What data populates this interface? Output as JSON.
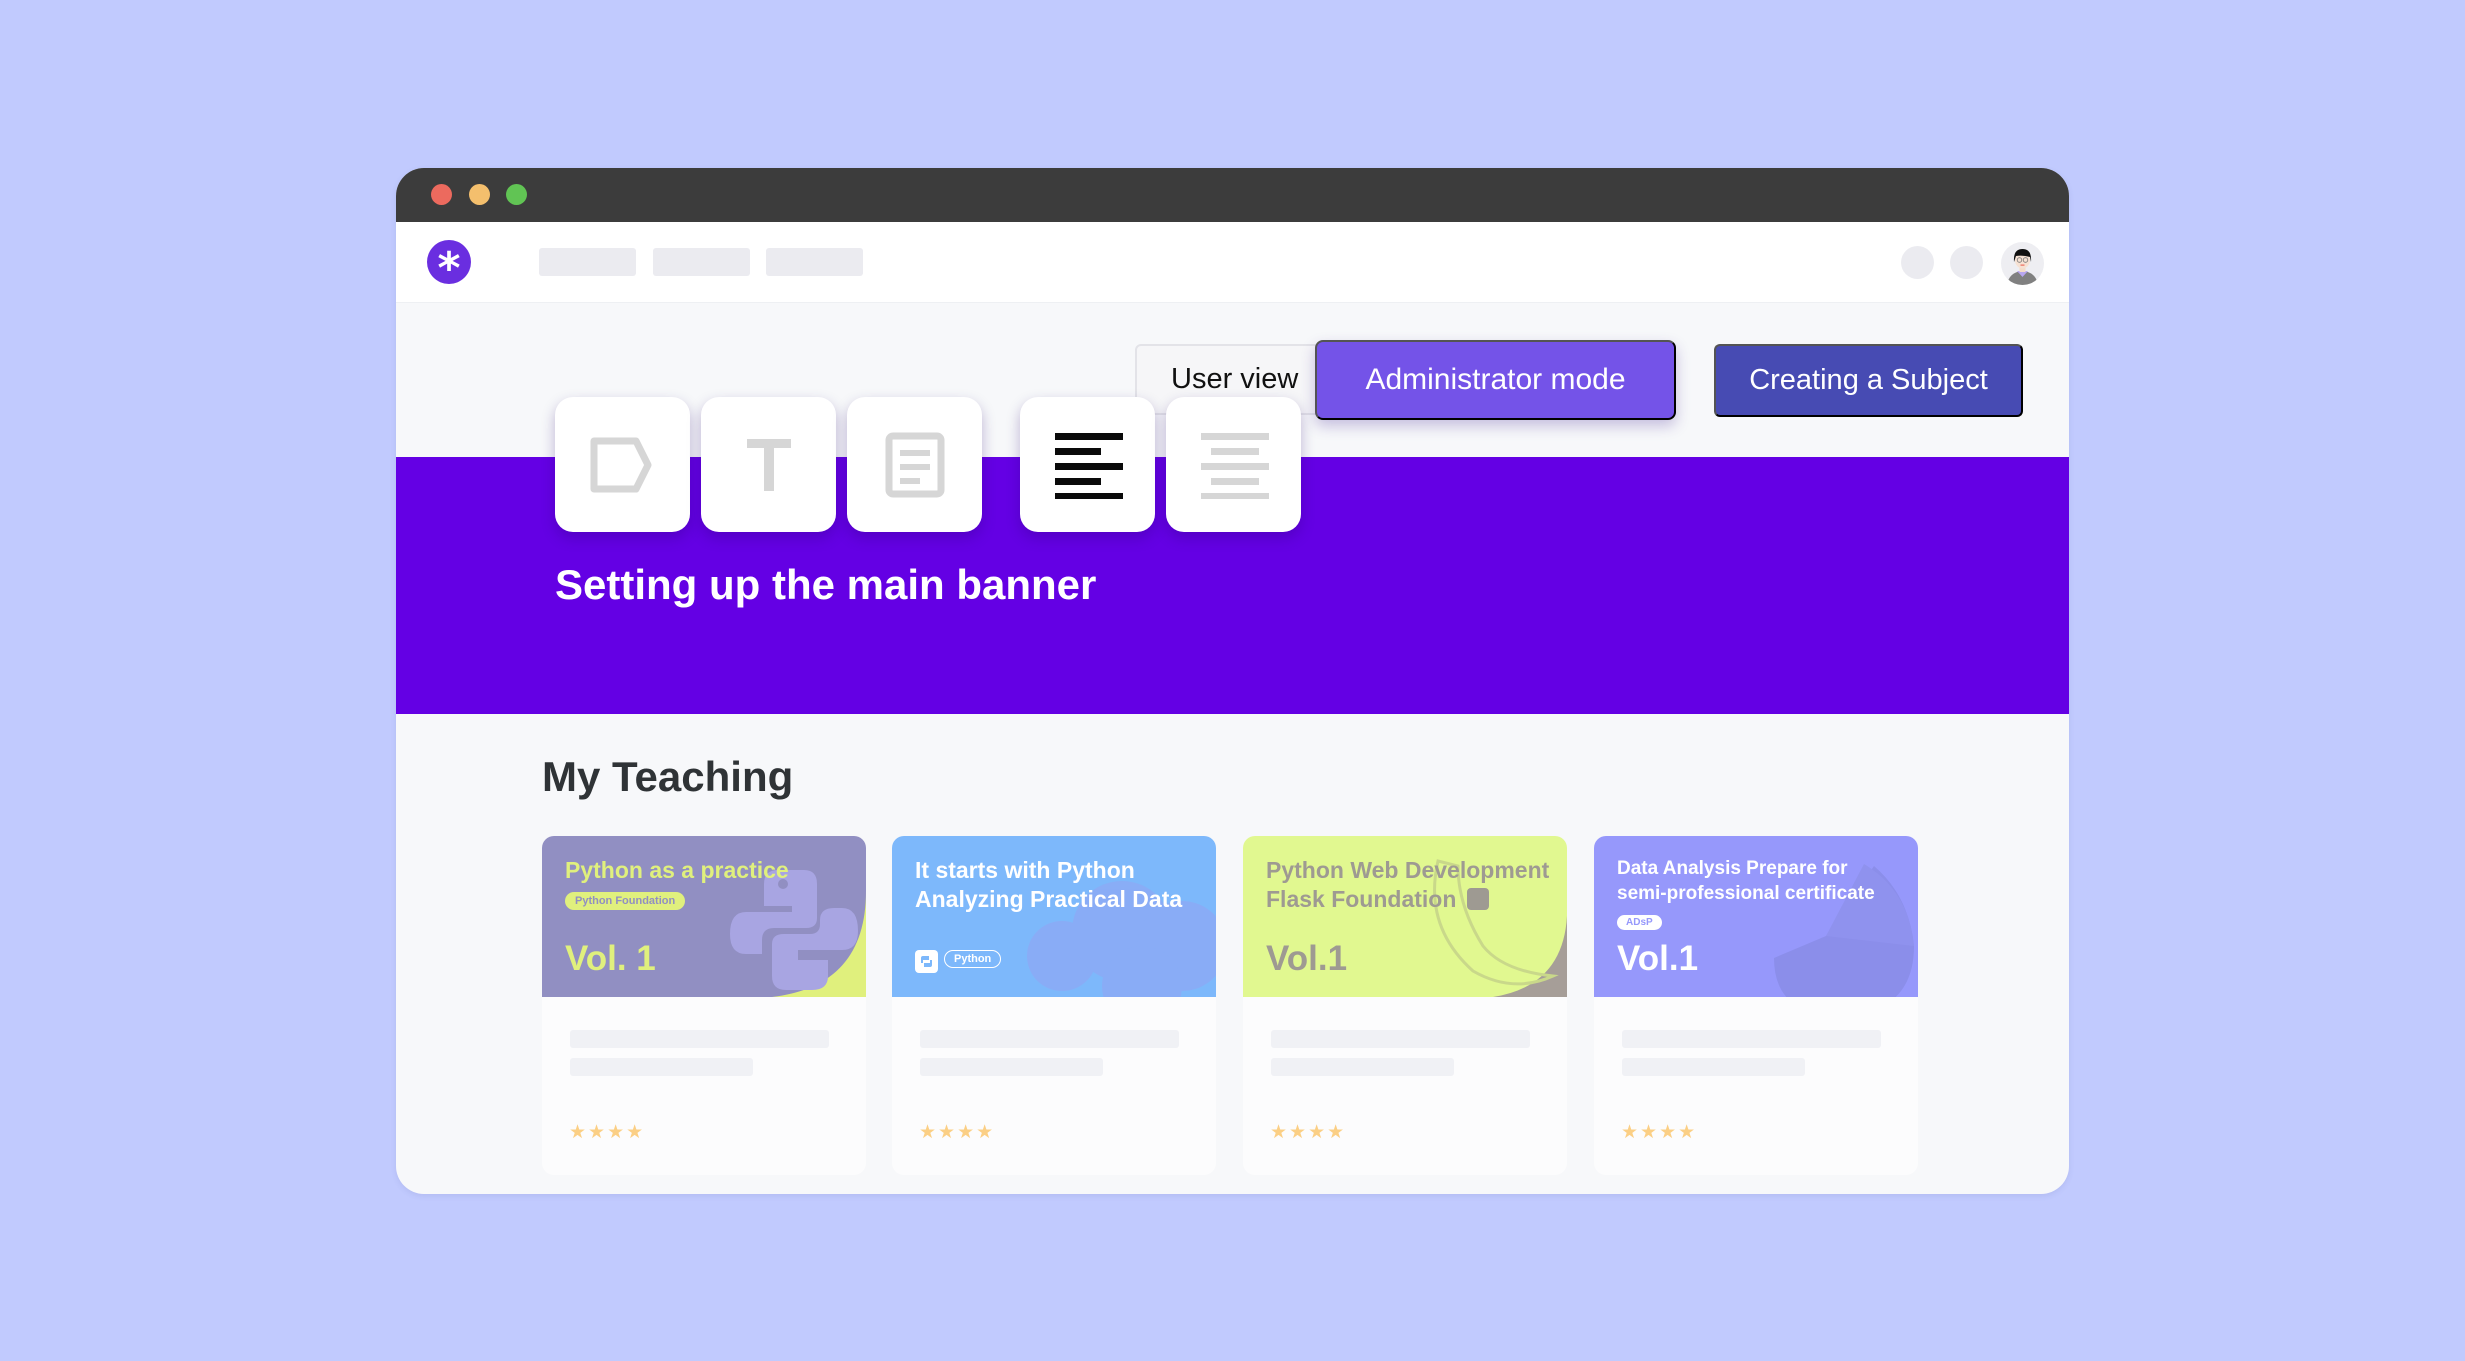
{
  "window": {
    "traffic_lights": [
      "close",
      "minimize",
      "maximize"
    ]
  },
  "navbar": {
    "logo_icon": "asterisk-logo-icon",
    "logo_glyph": "*",
    "nav_placeholders": 3,
    "icon_placeholders": 2,
    "avatar_icon": "user-avatar-icon"
  },
  "toolbar": {
    "user_view_label": "User view",
    "admin_mode_label": "Administrator mode",
    "create_subject_label": "Creating a Subject"
  },
  "banner": {
    "title": "Setting up the main banner",
    "color": "#6400e4",
    "tools": [
      {
        "name": "label-tag-icon",
        "active": false
      },
      {
        "name": "text-icon",
        "active": false
      },
      {
        "name": "document-icon",
        "active": false
      },
      {
        "name": "align-left-icon",
        "active": true
      },
      {
        "name": "align-center-icon",
        "active": false
      }
    ]
  },
  "teaching": {
    "title": "My Teaching",
    "courses": [
      {
        "title_lines": [
          "Python as a practice"
        ],
        "tag": "Python Foundation",
        "volume": "Vol. 1",
        "cover_color": "#918fc2",
        "text_color": "#e0f07d",
        "rating": 4
      },
      {
        "title_lines": [
          "It starts with Python",
          "Analyzing Practical Data"
        ],
        "tag": "Python",
        "volume": "",
        "cover_color": "#7db8fb",
        "text_color": "#ffffff",
        "rating": 4
      },
      {
        "title_lines": [
          "Python Web Development",
          "Flask Foundation"
        ],
        "tag": "",
        "volume": "Vol.1",
        "cover_color": "#e1f890",
        "text_color": "#9e9a92",
        "rating": 4
      },
      {
        "title_lines": [
          "Data Analysis Prepare for",
          "semi-professional certificate"
        ],
        "tag": "ADsP",
        "volume": "Vol.1",
        "cover_color": "#9698fb",
        "text_color": "#ffffff",
        "rating": 4
      }
    ]
  },
  "colors": {
    "background": "#c1cafe",
    "accent_purple": "#7453e8",
    "indigo_button": "#474bb3",
    "star": "#fbcf85"
  }
}
